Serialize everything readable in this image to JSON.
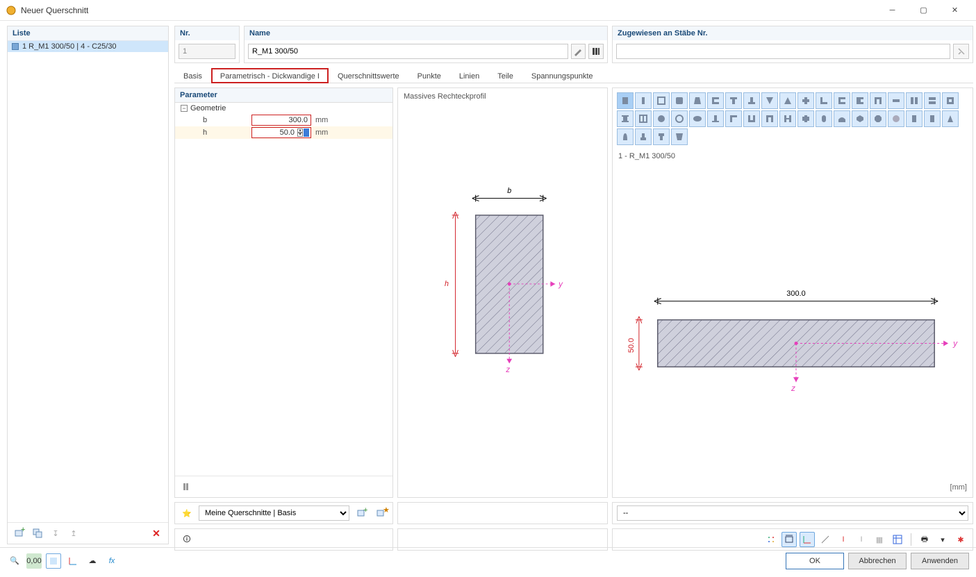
{
  "window": {
    "title": "Neuer Querschnitt"
  },
  "left": {
    "header": "Liste",
    "item": "1  R_M1 300/50 | 4 - C25/30"
  },
  "fields": {
    "nr_label": "Nr.",
    "nr_value": "1",
    "name_label": "Name",
    "name_value": "R_M1 300/50",
    "assigned_label": "Zugewiesen an Stäbe Nr.",
    "assigned_value": ""
  },
  "tabs": {
    "basis": "Basis",
    "param": "Parametrisch - Dickwandige I",
    "qwerte": "Querschnittswerte",
    "punkte": "Punkte",
    "linien": "Linien",
    "teile": "Teile",
    "spannung": "Spannungspunkte"
  },
  "parameters": {
    "header": "Parameter",
    "geometry": "Geometrie",
    "b_name": "b",
    "b_value": "300.0",
    "h_name": "h",
    "h_value": "50.0",
    "unit": "mm"
  },
  "preview": {
    "title": "Massives Rechteckprofil",
    "b_label": "b",
    "h_label": "h",
    "y": "y",
    "z": "z"
  },
  "right": {
    "section_label": "1 - R_M1 300/50",
    "dim_b": "300.0",
    "dim_h": "50.0",
    "y": "y",
    "z": "z",
    "mm": "[mm]",
    "dropdown": "--"
  },
  "lower": {
    "dropdown": "Meine Querschnitte | Basis"
  },
  "footer": {
    "ok": "OK",
    "cancel": "Abbrechen",
    "apply": "Anwenden"
  }
}
